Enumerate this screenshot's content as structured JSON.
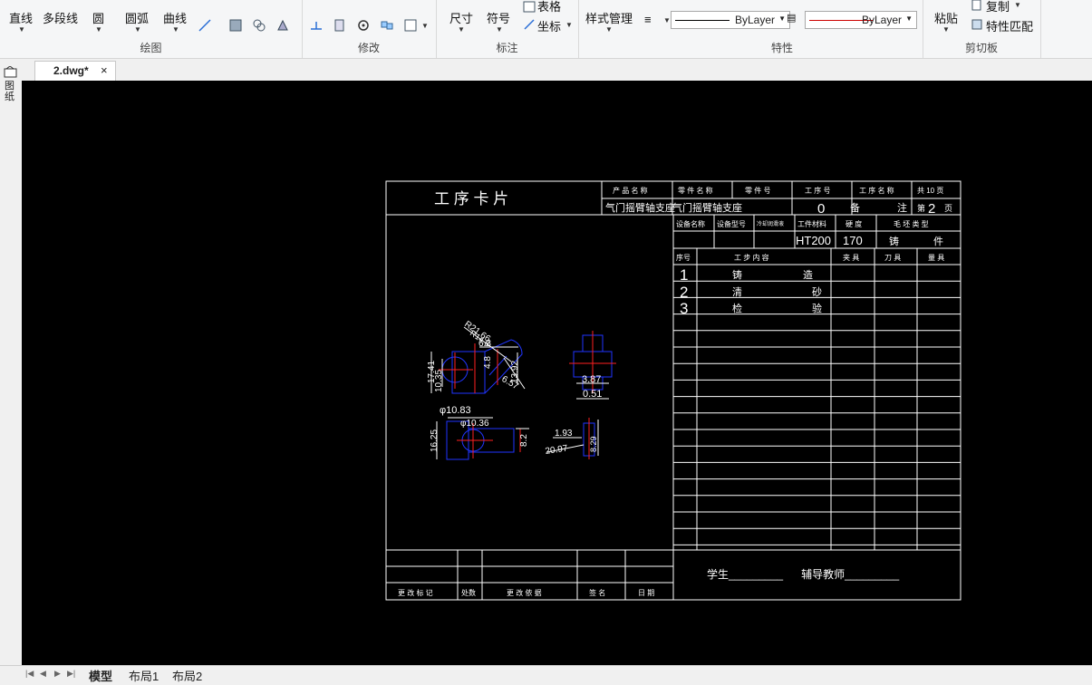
{
  "ribbon": {
    "draw": {
      "label": "绘图",
      "line": "直线",
      "polyline": "多段线",
      "circle": "圆",
      "arc": "圆弧",
      "curve": "曲线"
    },
    "modify": {
      "label": "修改"
    },
    "annotate": {
      "label": "标注",
      "dimension": "尺寸",
      "symbol": "符号",
      "table": "表格",
      "coordinate": "坐标"
    },
    "style": {
      "label": "样式管理"
    },
    "properties": {
      "label": "特性",
      "color_value": "ByLayer",
      "linetype_value": "ByLayer"
    },
    "clipboard": {
      "label": "剪切板",
      "paste": "粘贴",
      "copy": "复制",
      "match": "特性匹配"
    }
  },
  "document": {
    "tab": "2.dwg*",
    "close": "×"
  },
  "side_tool": {
    "label": "图纸"
  },
  "layouts": {
    "model": "模型",
    "layout1": "布局1",
    "layout2": "布局2"
  },
  "colors": {
    "canvas": "#000000",
    "line_blue": "#2035ff",
    "line_red": "#ff2020",
    "dim": "#ffffff"
  },
  "drawing": {
    "title": "工 序 卡 片",
    "header": {
      "product_name": "产 品 名 称",
      "part_name": "零 件 名 称",
      "part_no": "零 件 号",
      "process_no": "工 序 号",
      "process_name": "工 序 名 称",
      "total": "共 10 页",
      "product_value": "气门摇臂轴支座",
      "part_value": "气门摇臂轴支座",
      "process_no_value": "0",
      "remark_a": "备",
      "remark_b": "注",
      "page": "第",
      "page_no": "2",
      "page_unit": "页"
    },
    "equip": {
      "equip_name": "设备名称",
      "equip_model": "设备型号",
      "coolant": "冷却润滑液",
      "material": "工件材料",
      "hardness": "硬 度",
      "blank_type": "毛 坯 类 型",
      "material_value": "HT200",
      "hardness_value": "170",
      "blank_value_a": "铸",
      "blank_value_b": "件"
    },
    "steps_header": {
      "no": "序号",
      "content": "工 步 内 容",
      "fixture": "夹 具",
      "tool": "刀 具",
      "gauge": "量 具"
    },
    "steps": [
      {
        "no": "1",
        "a": "铸",
        "b": "造"
      },
      {
        "no": "2",
        "a": "清",
        "b": "砂"
      },
      {
        "no": "3",
        "a": "检",
        "b": "验"
      }
    ],
    "revision": {
      "mark": "更 改 标 记",
      "count": "处数",
      "basis": "更 改 依 据",
      "sign": "签 名",
      "date": "日 期"
    },
    "signature": "学生_________      辅导教师_________",
    "dims": {
      "d1": "R21.66",
      "d2": "R14.6",
      "d3": "6.3",
      "d4": "4.8",
      "d5": "13.92",
      "d6": "6.57",
      "d7": "17.41",
      "d8": "10.35",
      "d9": "φ10.83",
      "d10": "φ10.36",
      "d11": "16.25",
      "d12": "8.2",
      "d13": "3.87",
      "d14": "0.51",
      "d15": "1.93",
      "d16": "20.97",
      "d17": "8.29"
    }
  }
}
